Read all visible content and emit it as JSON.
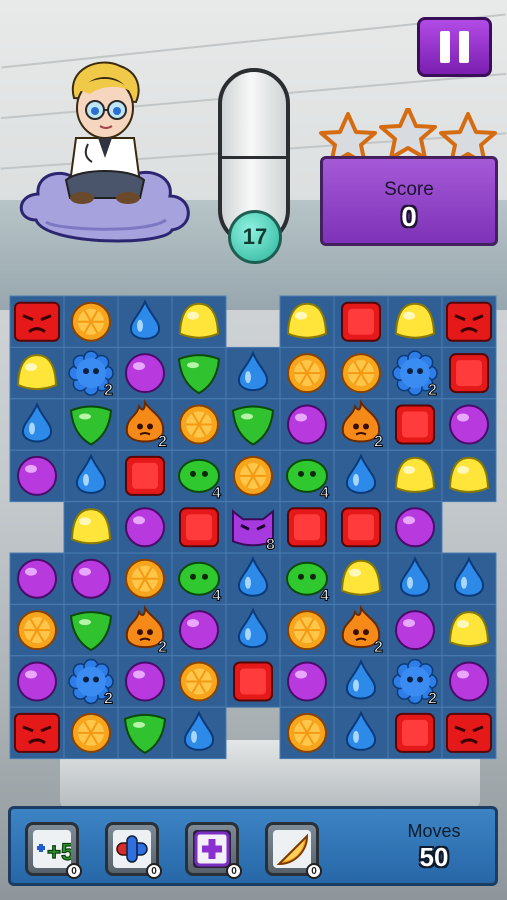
{
  "score": {
    "label": "Score",
    "value": "0"
  },
  "moves_left_bubble": "17",
  "moves": {
    "label": "Moves",
    "value": "50"
  },
  "stars": {
    "earned": 0,
    "total": 3
  },
  "boosters": [
    {
      "name": "plus-five-moves",
      "label": "+5",
      "count": "0"
    },
    {
      "name": "pill",
      "count": "0"
    },
    {
      "name": "plus-cross",
      "count": "0"
    },
    {
      "name": "orange-slice",
      "count": "0"
    }
  ],
  "colors": {
    "board": "#2f5f94",
    "accent_purple": "#8b39c6",
    "bar_blue": "#2f74b6"
  },
  "board": {
    "cols": 9,
    "rows": 9,
    "cells": [
      [
        "bad-red",
        "orange",
        "blue-drop",
        "yellow",
        "hole",
        "yellow",
        "red",
        "yellow",
        "bad-red"
      ],
      [
        "yellow",
        "blue-virus:2",
        "purple",
        "green",
        "blue-drop",
        "orange",
        "orange",
        "blue-virus:2",
        "red"
      ],
      [
        "blue-drop",
        "green",
        "fire:2",
        "orange",
        "green",
        "purple",
        "fire:2",
        "red",
        "purple"
      ],
      [
        "purple",
        "blue-drop",
        "red",
        "green-virus:4",
        "orange",
        "green-virus:4",
        "blue-drop",
        "yellow",
        "yellow"
      ],
      [
        "hole",
        "yellow",
        "purple",
        "red",
        "purple-virus:8",
        "red",
        "red",
        "purple",
        "hole"
      ],
      [
        "purple",
        "purple",
        "orange",
        "green-virus:4",
        "blue-drop",
        "green-virus:4",
        "yellow",
        "blue-drop",
        "blue-drop"
      ],
      [
        "orange",
        "green",
        "fire:2",
        "purple",
        "blue-drop",
        "orange",
        "fire:2",
        "purple",
        "yellow"
      ],
      [
        "purple",
        "blue-virus:2",
        "purple",
        "orange",
        "red",
        "purple",
        "blue-drop",
        "blue-virus:2",
        "purple"
      ],
      [
        "bad-red",
        "orange",
        "green",
        "blue-drop",
        "hole",
        "orange",
        "blue-drop",
        "red",
        "bad-red"
      ]
    ]
  }
}
